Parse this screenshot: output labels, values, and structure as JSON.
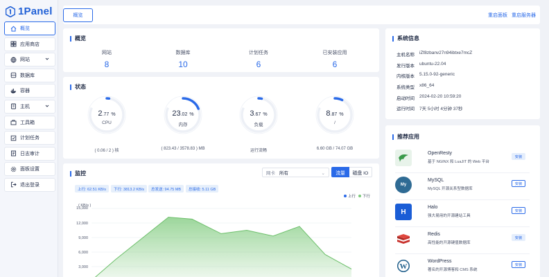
{
  "brand": {
    "name": "1Panel",
    "color": "#2a6ae8"
  },
  "sidebar": {
    "items": [
      {
        "label": "概览",
        "icon": "home-icon"
      },
      {
        "label": "应用商店",
        "icon": "apps-icon"
      },
      {
        "label": "网站",
        "icon": "globe-icon"
      },
      {
        "label": "数据库",
        "icon": "database-icon"
      },
      {
        "label": "容器",
        "icon": "whale-icon"
      },
      {
        "label": "主机",
        "icon": "host-icon"
      },
      {
        "label": "工具箱",
        "icon": "toolbox-icon"
      },
      {
        "label": "计划任务",
        "icon": "task-icon"
      },
      {
        "label": "日志审计",
        "icon": "log-icon"
      },
      {
        "label": "面板设置",
        "icon": "settings-icon"
      },
      {
        "label": "退出登录",
        "icon": "logout-icon"
      }
    ]
  },
  "topbar": {
    "tab": "概览",
    "restart_panel": "重启面板",
    "restart_server": "重启服务器"
  },
  "overview": {
    "title": "概览",
    "items": [
      {
        "label": "网站",
        "value": "8"
      },
      {
        "label": "数据库",
        "value": "10"
      },
      {
        "label": "计划任务",
        "value": "6"
      },
      {
        "label": "已安装应用",
        "value": "6"
      }
    ]
  },
  "status": {
    "title": "状态",
    "gauges": [
      {
        "int": "2",
        "dec": ".77",
        "unit": "%",
        "label": "CPU",
        "footer": "( 0.06 / 2 ) 核",
        "percent": 2.77
      },
      {
        "int": "23",
        "dec": ".02",
        "unit": "%",
        "label": "内存",
        "footer": "( 823.43 / 3578.83 ) MB",
        "percent": 23.02
      },
      {
        "int": "3",
        "dec": ".67",
        "unit": "%",
        "label": "负载",
        "footer": "运行流畅",
        "percent": 3.67
      },
      {
        "int": "8",
        "dec": ".87",
        "unit": "%",
        "label": "/",
        "footer": "6.60 GB / 74.07 GB",
        "percent": 8.87
      }
    ]
  },
  "monitor": {
    "title": "监控",
    "select_prefix": "网卡",
    "select_value": "所有",
    "seg_traffic": "流量",
    "seg_disk": "磁盘 IO",
    "tags": [
      "上行: 62.51 KB/s",
      "下行: 3813.2 KB/s",
      "总发送: 94.75 MB",
      "总接收: 5.11 GB"
    ],
    "legend_up": "上行",
    "legend_down": "下行",
    "unit": "( KB/s )",
    "colors": {
      "up": "#2a6ae8",
      "down": "#7cc97a"
    }
  },
  "chart_data": {
    "type": "area",
    "ylabel": "( KB/s )",
    "ylim": [
      0,
      15000
    ],
    "yticks": [
      "15,000",
      "12,000",
      "9,000",
      "6,000",
      "3,000"
    ],
    "series": [
      {
        "name": "上行",
        "values": [
          60,
          60,
          60,
          60,
          60,
          60,
          60,
          60,
          60
        ]
      },
      {
        "name": "下行",
        "values": [
          150,
          4500,
          13200,
          12800,
          9800,
          10500,
          9300,
          11300,
          5500,
          2500
        ]
      }
    ]
  },
  "sysinfo": {
    "title": "系统信息",
    "rows": [
      {
        "k": "主机名称",
        "v": "iZf8zbanv27n94ibtxe7mcZ"
      },
      {
        "k": "发行版本",
        "v": "ubuntu-22.04"
      },
      {
        "k": "内核版本",
        "v": "5.15.0-92-generic"
      },
      {
        "k": "系统类型",
        "v": "x86_64"
      },
      {
        "k": "启动时间",
        "v": "2024-02-20 10:59:20"
      },
      {
        "k": "运行时间",
        "v": "7天 5小时 4分钟 37秒"
      }
    ]
  },
  "apps": {
    "title": "推荐应用",
    "items": [
      {
        "name": "OpenResty",
        "desc": "基于 NGINX 和 LuaJIT 的 Web 平台",
        "button": "安装",
        "icon": "openresty-icon",
        "color": "#e8f3ea"
      },
      {
        "name": "MySQL",
        "desc": "MySQL 开源关系型数据库",
        "button": "安装",
        "icon": "mysql-icon",
        "color": "#2f6b94"
      },
      {
        "name": "Halo",
        "desc": "强大易用的开源建站工具",
        "button": "安装",
        "icon": "halo-icon",
        "color": "#1a5dd6"
      },
      {
        "name": "Redis",
        "desc": "高性能的开源键值数据库",
        "button": "安装",
        "icon": "redis-icon",
        "color": "#c8312c"
      },
      {
        "name": "WordPress",
        "desc": "著名的开源博客和 CMS 系统",
        "button": "安装",
        "icon": "wordpress-icon",
        "color": "#1f5e8a"
      }
    ]
  }
}
